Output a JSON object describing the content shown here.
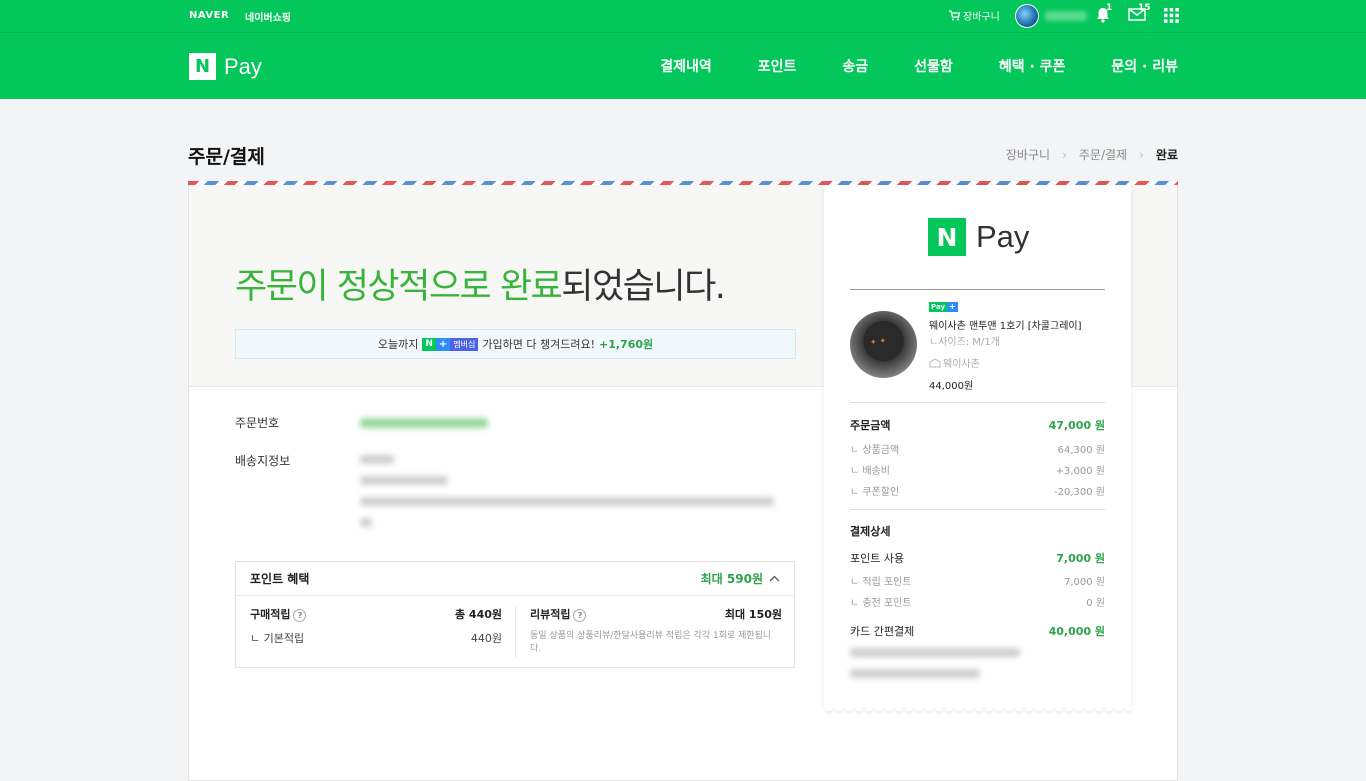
{
  "topbar": {
    "naver": "NAVER",
    "shopping": "네이버쇼핑",
    "cart": "장바구니",
    "notif_count": "1",
    "mail_count": "15"
  },
  "header": {
    "nav": [
      "결제내역",
      "포인트",
      "송금",
      "선물함",
      "혜택 · 쿠폰",
      "문의 · 리뷰"
    ],
    "pay_label": "Pay",
    "n_label": "N"
  },
  "page": {
    "title": "주문/결제",
    "breadcrumb": [
      "장바구니",
      "주문/결제",
      "완료"
    ]
  },
  "hero": {
    "highlight": "주문이 정상적으로 완료",
    "rest": "되었습니다."
  },
  "promo": {
    "prefix": "오늘까지",
    "badge_n": "N",
    "badge_plus": "+",
    "badge_member": "멤버십",
    "suffix": "가입하면 다 챙겨드려요!",
    "amount": "+1,760원"
  },
  "info": {
    "order_no_label": "주문번호",
    "delivery_label": "배송지정보"
  },
  "points": {
    "title": "포인트 혜택",
    "max": "최대 590원",
    "purchase_label": "구매적립",
    "purchase_total": "총 440원",
    "basic_label": "ㄴ 기본적립",
    "basic_value": "440원",
    "review_label": "리뷰적립",
    "review_max": "최대 150원",
    "review_note": "동일 상품의 상품리뷰/한달사용리뷰 적립은 각각 1회로 제한됩니다."
  },
  "receipt": {
    "n_label": "N",
    "pay_label": "Pay",
    "mini_badge": "Pay",
    "product_name": "웨이사촌 맨투맨 1호기 [차콜그레이]",
    "option": "ㄴ사이즈: M/1개",
    "seller": "웨이사촌",
    "price": "44,000원",
    "order_amount_label": "주문금액",
    "order_amount": "47,000 원",
    "lines": [
      {
        "label": "상품금액",
        "value": "64,300 원"
      },
      {
        "label": "배송비",
        "value": "+3,000 원"
      },
      {
        "label": "쿠폰할인",
        "value": "-20,300 원"
      }
    ],
    "payment_detail_label": "결제상세",
    "point_use_label": "포인트 사용",
    "point_use": "7,000 원",
    "point_lines": [
      {
        "label": "적립 포인트",
        "value": "7,000 원"
      },
      {
        "label": "충전 포인트",
        "value": "0 원"
      }
    ],
    "card_label": "카드 간편결제",
    "card_amount": "40,000 원"
  },
  "colors": {
    "brand_green": "#03c75a",
    "text_green": "#2fa34a",
    "hero_green": "#38b43a"
  }
}
